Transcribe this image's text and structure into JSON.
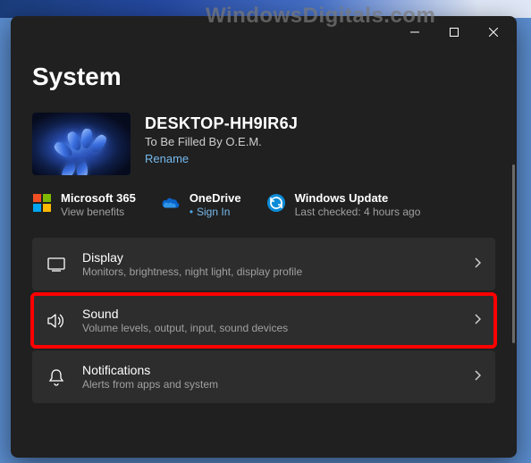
{
  "watermark": "WindowsDigitals.com",
  "page": {
    "title": "System"
  },
  "device": {
    "name": "DESKTOP-HH9IR6J",
    "sub": "To Be Filled By O.E.M.",
    "rename": "Rename"
  },
  "services": {
    "m365": {
      "title": "Microsoft 365",
      "sub": "View benefits"
    },
    "onedrive": {
      "title": "OneDrive",
      "sub": "Sign In"
    },
    "windows_update": {
      "title": "Windows Update",
      "sub": "Last checked: 4 hours ago"
    }
  },
  "items": {
    "display": {
      "title": "Display",
      "sub": "Monitors, brightness, night light, display profile"
    },
    "sound": {
      "title": "Sound",
      "sub": "Volume levels, output, input, sound devices"
    },
    "notifications": {
      "title": "Notifications",
      "sub": "Alerts from apps and system"
    }
  }
}
